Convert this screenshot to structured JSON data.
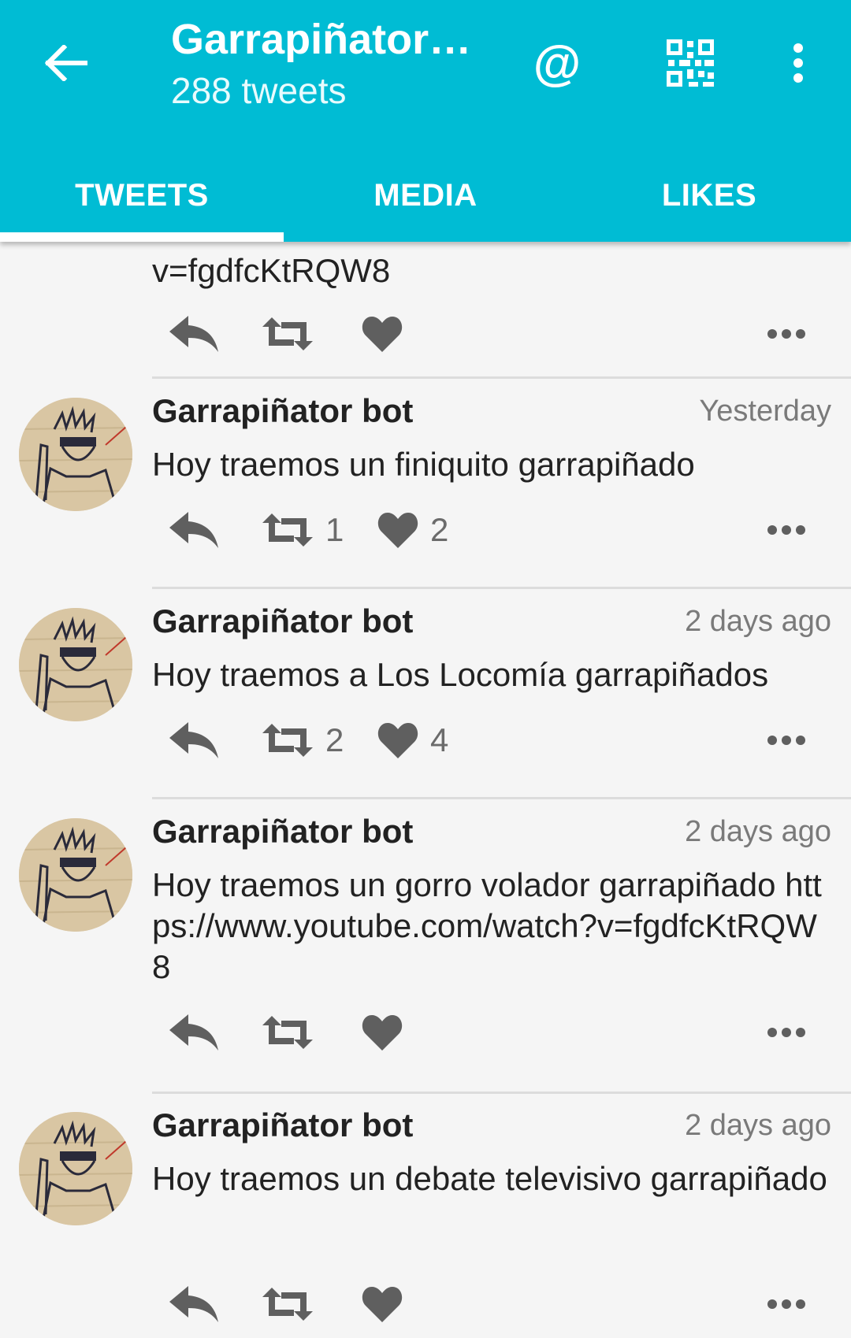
{
  "header": {
    "title": "Garrapiñator…",
    "subtitle": "288 tweets",
    "at_symbol": "@",
    "icons": [
      "back-arrow-icon",
      "mention-icon",
      "qr-code-icon",
      "overflow-menu-icon"
    ],
    "accent_color": "#00bcd4"
  },
  "tabs": [
    {
      "label": "TWEETS",
      "active": true
    },
    {
      "label": "MEDIA",
      "active": false
    },
    {
      "label": "LIKES",
      "active": false
    }
  ],
  "partial_tweet": {
    "text": "v=fgdfcKtRQW8"
  },
  "tweets": [
    {
      "author": "Garrapiñator bot",
      "time": "Yesterday",
      "text": "Hoy traemos un finiquito garrapiñado",
      "retweets": "1",
      "likes": "2"
    },
    {
      "author": "Garrapiñator bot",
      "time": "2 days ago",
      "text": "Hoy traemos a Los Locomía garrapiñados",
      "retweets": "2",
      "likes": "4"
    },
    {
      "author": "Garrapiñator bot",
      "time": "2 days ago",
      "text": "Hoy traemos un gorro volador garrapiñado https://www.youtube.com/watch?v=fgdfcKtRQW8",
      "retweets": "",
      "likes": ""
    },
    {
      "author": "Garrapiñator bot",
      "time": "2 days ago",
      "text": "Hoy traemos un debate televisivo garrapiñado",
      "retweets": "",
      "likes": ""
    }
  ]
}
